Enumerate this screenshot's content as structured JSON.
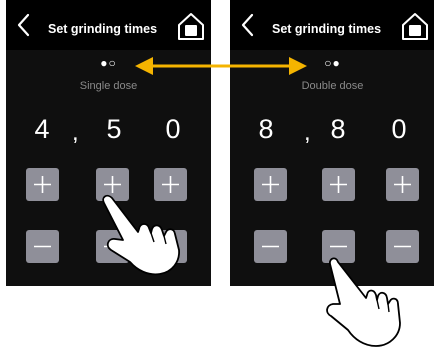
{
  "screens": [
    {
      "title": "Set grinding times",
      "dose_indicator": "●○",
      "dose_label": "Single dose",
      "digits": [
        "4",
        "5",
        "0"
      ],
      "separator": ",",
      "plus_symbol": "+",
      "minus_symbol": "−"
    },
    {
      "title": "Set grinding times",
      "dose_indicator": "○●",
      "dose_label": "Double dose",
      "digits": [
        "8",
        "8",
        "0"
      ],
      "separator": ",",
      "plus_symbol": "+",
      "minus_symbol": "−"
    }
  ],
  "icons": {
    "back": "chevron-left-icon",
    "home": "home-icon",
    "arrow": "double-arrow-icon",
    "hand": "pointing-hand-icon"
  },
  "colors": {
    "screen_bg": "#0f0f0f",
    "button": "#8f8f99",
    "arrow": "#f5b400",
    "label": "#8a8a8a"
  }
}
